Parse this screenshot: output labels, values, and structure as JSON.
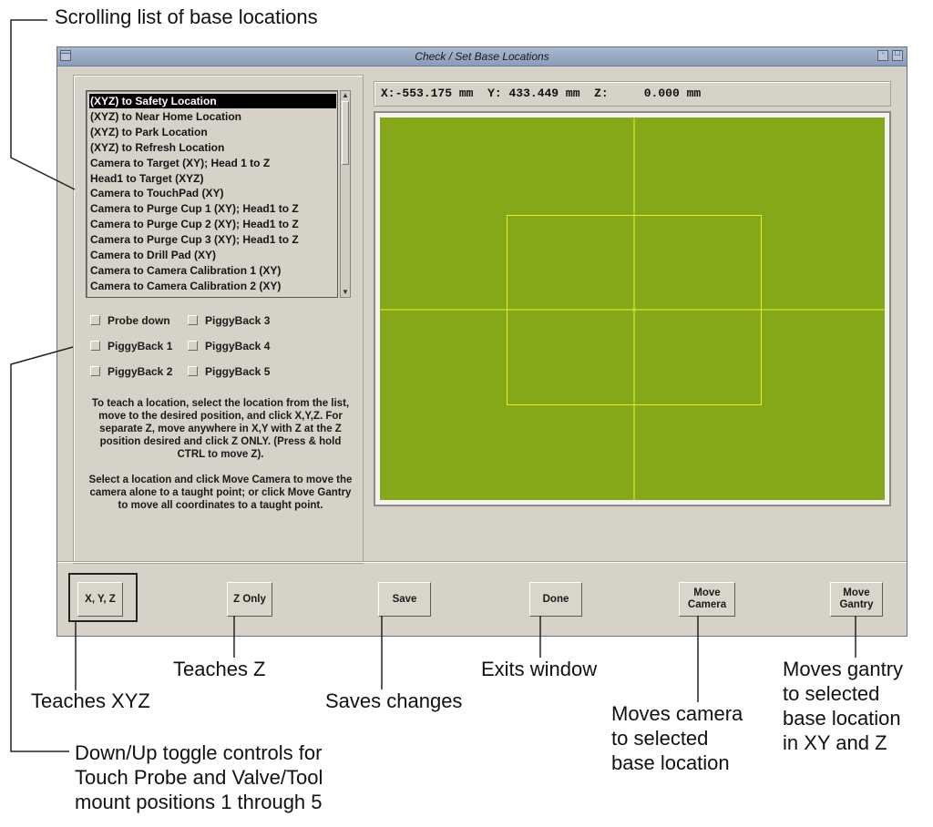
{
  "callouts": {
    "scrolling_list": "Scrolling list of base locations",
    "teaches_xyz": "Teaches XYZ",
    "teaches_z": "Teaches Z",
    "saves_changes": "Saves changes",
    "exits_window": "Exits window",
    "moves_camera": [
      "Moves camera",
      "to selected",
      "base location"
    ],
    "moves_gantry": [
      "Moves gantry",
      "to selected",
      "base location",
      "in XY and Z"
    ],
    "toggle_controls": [
      "Down/Up toggle controls for",
      "Touch Probe and Valve/Tool",
      "mount positions 1 through 5"
    ]
  },
  "window": {
    "title": "Check / Set Base Locations",
    "coords": {
      "x_label": "X:",
      "x_value": "-553.175",
      "y_label": "Y:",
      "y_value": "433.449",
      "z_label": "Z:",
      "z_value": "0.000",
      "unit": "mm"
    },
    "locations": [
      "(XYZ) to Safety Location",
      "(XYZ) to Near Home Location",
      "(XYZ) to Park Location",
      "(XYZ) to Refresh Location",
      "Camera to Target (XY); Head 1 to Z",
      "Head1 to Target (XYZ)",
      "Camera to TouchPad (XY)",
      "Camera to Purge Cup 1 (XY); Head1 to Z",
      "Camera to Purge Cup 2 (XY); Head1 to Z",
      "Camera to Purge Cup 3 (XY); Head1 to Z",
      "Camera to Drill Pad (XY)",
      "Camera to Camera Calibration 1 (XY)",
      "Camera to Camera Calibration 2 (XY)"
    ],
    "selected_index": 0,
    "checkboxes": [
      {
        "label": "Probe down",
        "checked": false
      },
      {
        "label": "PiggyBack 1",
        "checked": false
      },
      {
        "label": "PiggyBack 2",
        "checked": false
      },
      {
        "label": "PiggyBack 3",
        "checked": false
      },
      {
        "label": "PiggyBack 4",
        "checked": false
      },
      {
        "label": "PiggyBack 5",
        "checked": false
      }
    ],
    "instructions": [
      "To teach a location, select the location from the list, move to the desired position,  and click X,Y,Z.  For separate Z,  move anywhere in X,Y with Z at the Z position desired and click Z ONLY.  (Press & hold CTRL to move Z).",
      "Select a location and click Move Camera to move the camera alone to a taught point; or click Move Gantry to move all coordinates to a taught point."
    ],
    "buttons": {
      "xyz": "X, Y, Z",
      "z_only": "Z Only",
      "save": "Save",
      "done": "Done",
      "move_camera": "Move\nCamera",
      "move_gantry": "Move\nGantry"
    },
    "colors": {
      "viewport_bg": "#85a81b",
      "crosshair": "#e8ef2a",
      "window_bg": "#d6d2c8",
      "titlebar": "#97a9c4"
    },
    "icons": [
      "window-menu-icon",
      "minimize-icon",
      "maximize-icon",
      "scroll-up-arrow-icon",
      "scroll-down-arrow-icon"
    ]
  }
}
